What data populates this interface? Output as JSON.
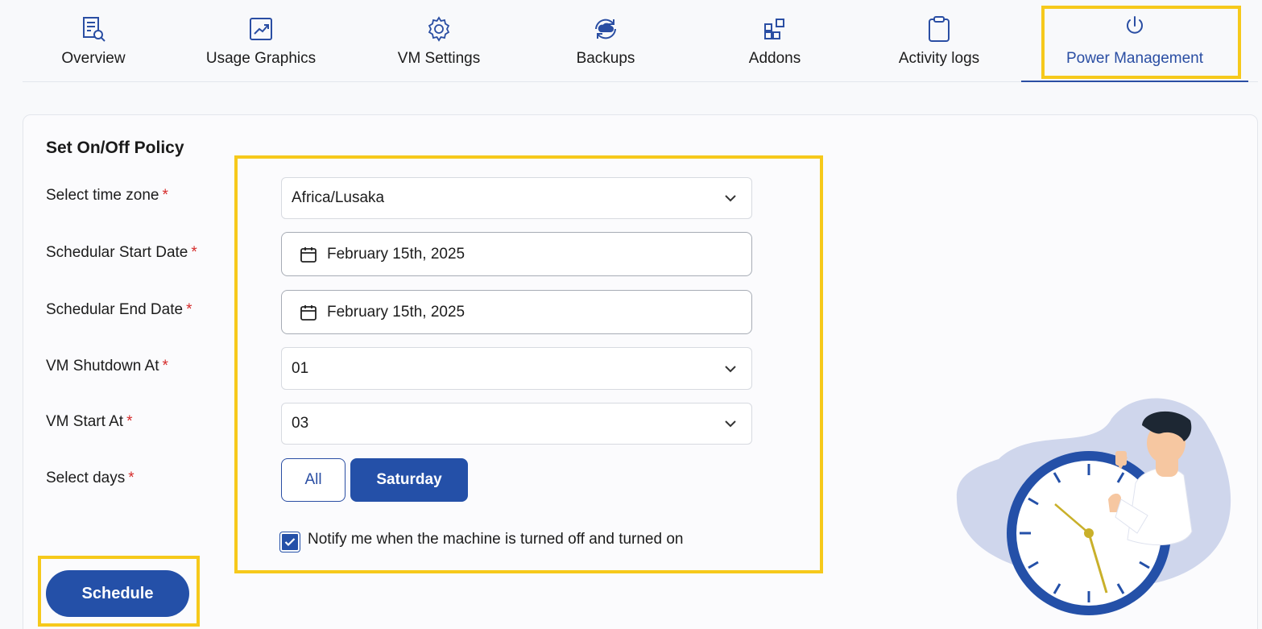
{
  "tabs": [
    {
      "label": "Overview",
      "icon": "document-search-icon"
    },
    {
      "label": "Usage Graphics",
      "icon": "chart-trend-icon"
    },
    {
      "label": "VM Settings",
      "icon": "gear-icon"
    },
    {
      "label": "Backups",
      "icon": "cloud-sync-icon"
    },
    {
      "label": "Addons",
      "icon": "grid-add-icon"
    },
    {
      "label": "Activity logs",
      "icon": "clipboard-icon"
    },
    {
      "label": "Power Management",
      "icon": "power-icon",
      "active": true
    }
  ],
  "form": {
    "title": "Set On/Off Policy",
    "timezone": {
      "label": "Select time zone",
      "value": "Africa/Lusaka"
    },
    "start_date": {
      "label": "Schedular Start Date",
      "value": "February 15th, 2025"
    },
    "end_date": {
      "label": "Schedular End Date",
      "value": "February 15th, 2025"
    },
    "shutdown": {
      "label": "VM Shutdown At",
      "value": "01"
    },
    "start": {
      "label": "VM Start At",
      "value": "03"
    },
    "days": {
      "label": "Select days",
      "options": [
        "All",
        "Saturday"
      ],
      "selected": "Saturday"
    },
    "required_marker": "*",
    "notify": {
      "label": "Notify me when the machine is turned off and turned on",
      "checked": true
    },
    "submit_label": "Schedule"
  },
  "colors": {
    "accent": "#2450a8",
    "highlight": "#f6c91b",
    "required": "#d52b2b"
  }
}
